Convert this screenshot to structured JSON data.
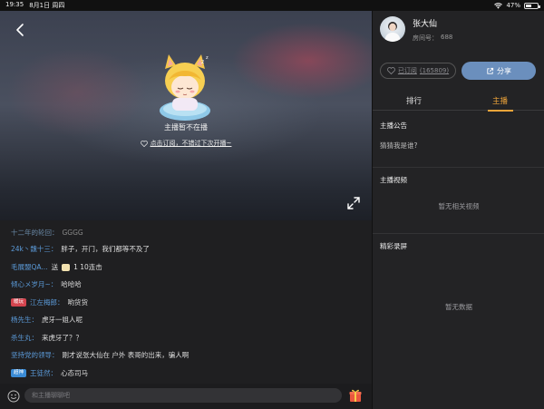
{
  "status_bar": {
    "time": "19:35",
    "date": "8月1日 周四",
    "battery": "47%",
    "battery_level": 0.47
  },
  "video": {
    "offline_text": "主播暂不在播",
    "subscribe_link": "点击订阅，不错过下次开播~",
    "icons": {
      "back": "chevron-left-icon",
      "expand": "fullscreen-icon",
      "heart": "heart-icon"
    }
  },
  "chat": {
    "messages": [
      {
        "user": "十二年的轮回：",
        "text": "GGGG",
        "dim": true
      },
      {
        "user": "24k丶魏十三：",
        "text": "胖子，开门，我们都等不及了"
      },
      {
        "user": "毛展盟QA...",
        "text": "送",
        "gift_suffix": "1  10连击"
      },
      {
        "user": "倾心メ岁月~：",
        "text": "哈哈哈"
      },
      {
        "user": "江左梅郎：",
        "text": "哟货货",
        "badge": "暖玩"
      },
      {
        "user": "杨先生：",
        "text": "虎牙一姐人呢"
      },
      {
        "user": "杀生丸：",
        "text": "来虎牙了？？"
      },
      {
        "user": "坚持党的领导：",
        "text": "刚才说张大仙在 户外 表哥的出来，骗人啊"
      },
      {
        "user": "王徒然：",
        "text": "心态司马",
        "badge": "超神"
      }
    ]
  },
  "input_bar": {
    "placeholder": "和主播聊聊吧",
    "icons": {
      "emoji": "emoji-icon",
      "gift": "gift-icon"
    }
  },
  "panel": {
    "streamer_name": "张大仙",
    "room_label": "房间号：",
    "room_number": "688",
    "subscribed_label": "已订阅",
    "subscriber_count": "(165809)",
    "share_label": "分享",
    "tabs": [
      "排行",
      "主播"
    ],
    "active_tab": "主播",
    "announcement_title": "主播公告",
    "announcement_text": "猜猜我是谁?",
    "videos_title": "主播视频",
    "videos_empty": "暂无相关视频",
    "recordings_title": "精彩录屏",
    "recordings_empty": "暂无数据"
  }
}
